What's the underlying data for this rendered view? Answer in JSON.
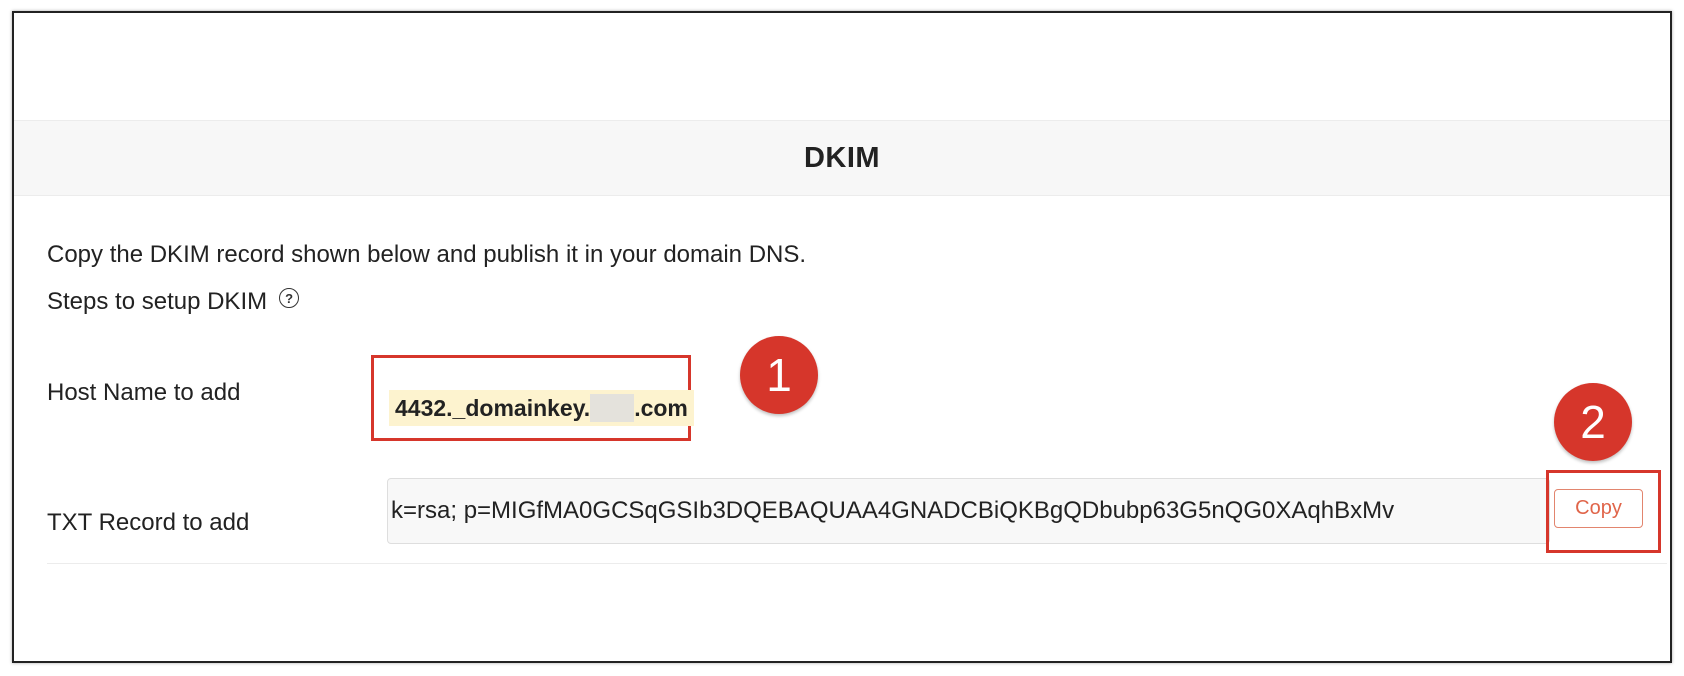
{
  "section": {
    "title": "DKIM"
  },
  "instructions": {
    "description": "Copy the DKIM record shown below and publish it in your domain DNS.",
    "steps_link": "Steps to setup DKIM",
    "help_icon": "question-circle-icon"
  },
  "host": {
    "label": "Host Name to add",
    "value_prefix": "4432._domainkey.",
    "value_suffix": ".com"
  },
  "txt_record": {
    "label": "TXT Record to add",
    "value": "k=rsa; p=MIGfMA0GCSqGSIb3DQEBAQUAA4GNADCBiQKBgQDbubp63G5nQG0XAqhBxMv"
  },
  "actions": {
    "copy_label": "Copy"
  },
  "annotations": {
    "badge_1": "1",
    "badge_2": "2"
  },
  "colors": {
    "annotation_red": "#d6362b",
    "copy_accent": "#e0654a",
    "highlight": "#fdf3cf"
  }
}
